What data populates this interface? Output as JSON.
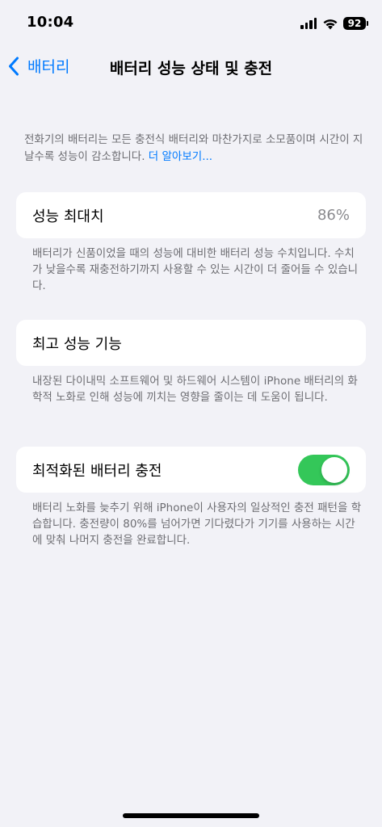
{
  "status_bar": {
    "time": "10:04",
    "battery_level": "92"
  },
  "nav": {
    "back_label": "배터리",
    "title": "배터리 성능 상태 및 충전"
  },
  "intro": {
    "text": "전화기의 배터리는 모든 충전식 배터리와 마찬가지로 소모품이며 시간이 지날수록 성능이 감소합니다. ",
    "link": "더 알아보기..."
  },
  "max_capacity": {
    "label": "성능 최대치",
    "value": "86%",
    "footnote": "배터리가 신품이었을 때의 성능에 대비한 배터리 성능 수치입니다. 수치가 낮을수록 재충전하기까지 사용할 수 있는 시간이 더 줄어들 수 있습니다."
  },
  "peak_performance": {
    "label": "최고 성능 기능",
    "footnote": "내장된 다이내믹 소프트웨어 및 하드웨어 시스템이 iPhone 배터리의 화학적 노화로 인해 성능에 끼치는 영향을 줄이는 데 도움이 됩니다."
  },
  "optimized_charging": {
    "label": "최적화된 배터리 충전",
    "enabled": true,
    "footnote": "배터리 노화를 늦추기 위해 iPhone이 사용자의 일상적인 충전 패턴을 학습합니다. 충전량이 80%를 넘어가면 기다렸다가 기기를 사용하는 시간에 맞춰 나머지 충전을 완료합니다."
  },
  "colors": {
    "accent": "#007aff",
    "toggle_on": "#34c759",
    "background": "#f2f2f7"
  }
}
